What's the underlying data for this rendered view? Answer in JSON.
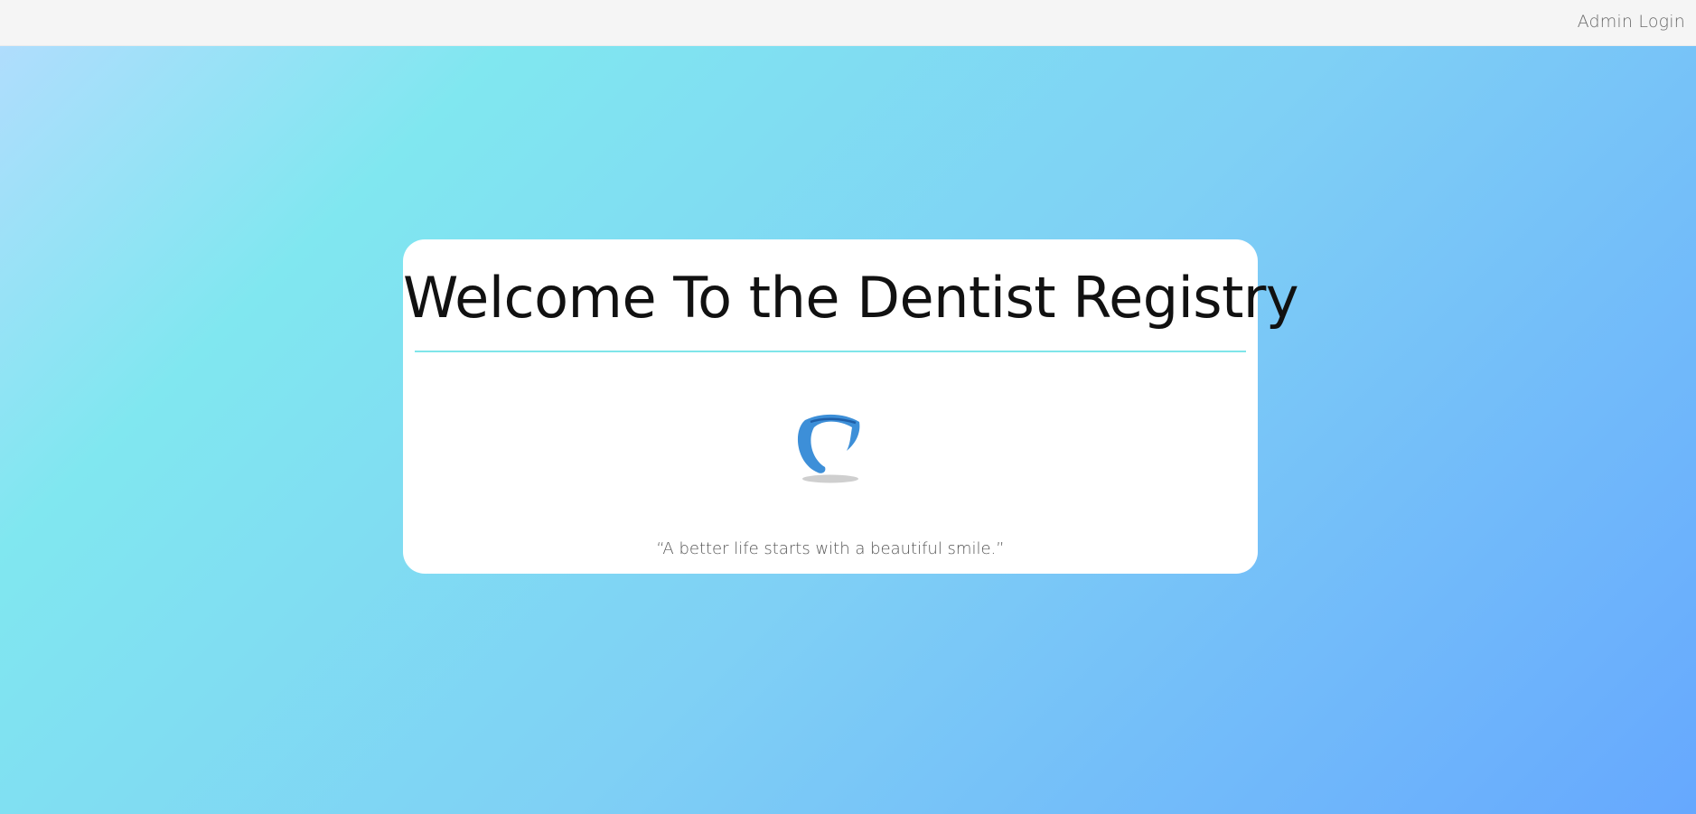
{
  "header": {
    "admin_login_label": "Admin Login"
  },
  "welcome_card": {
    "title": "Welcome To the Dentist Registry",
    "logo_icon": "tooth-icon",
    "quote": "“A better life starts with a beautiful smile.”"
  },
  "colors": {
    "accent_line": "#7fe5ea",
    "logo_blue": "#3d8fd8",
    "gradient_start": "#b4dcfe",
    "gradient_mid": "#80e7f0",
    "gradient_end": "#66a8fe"
  }
}
